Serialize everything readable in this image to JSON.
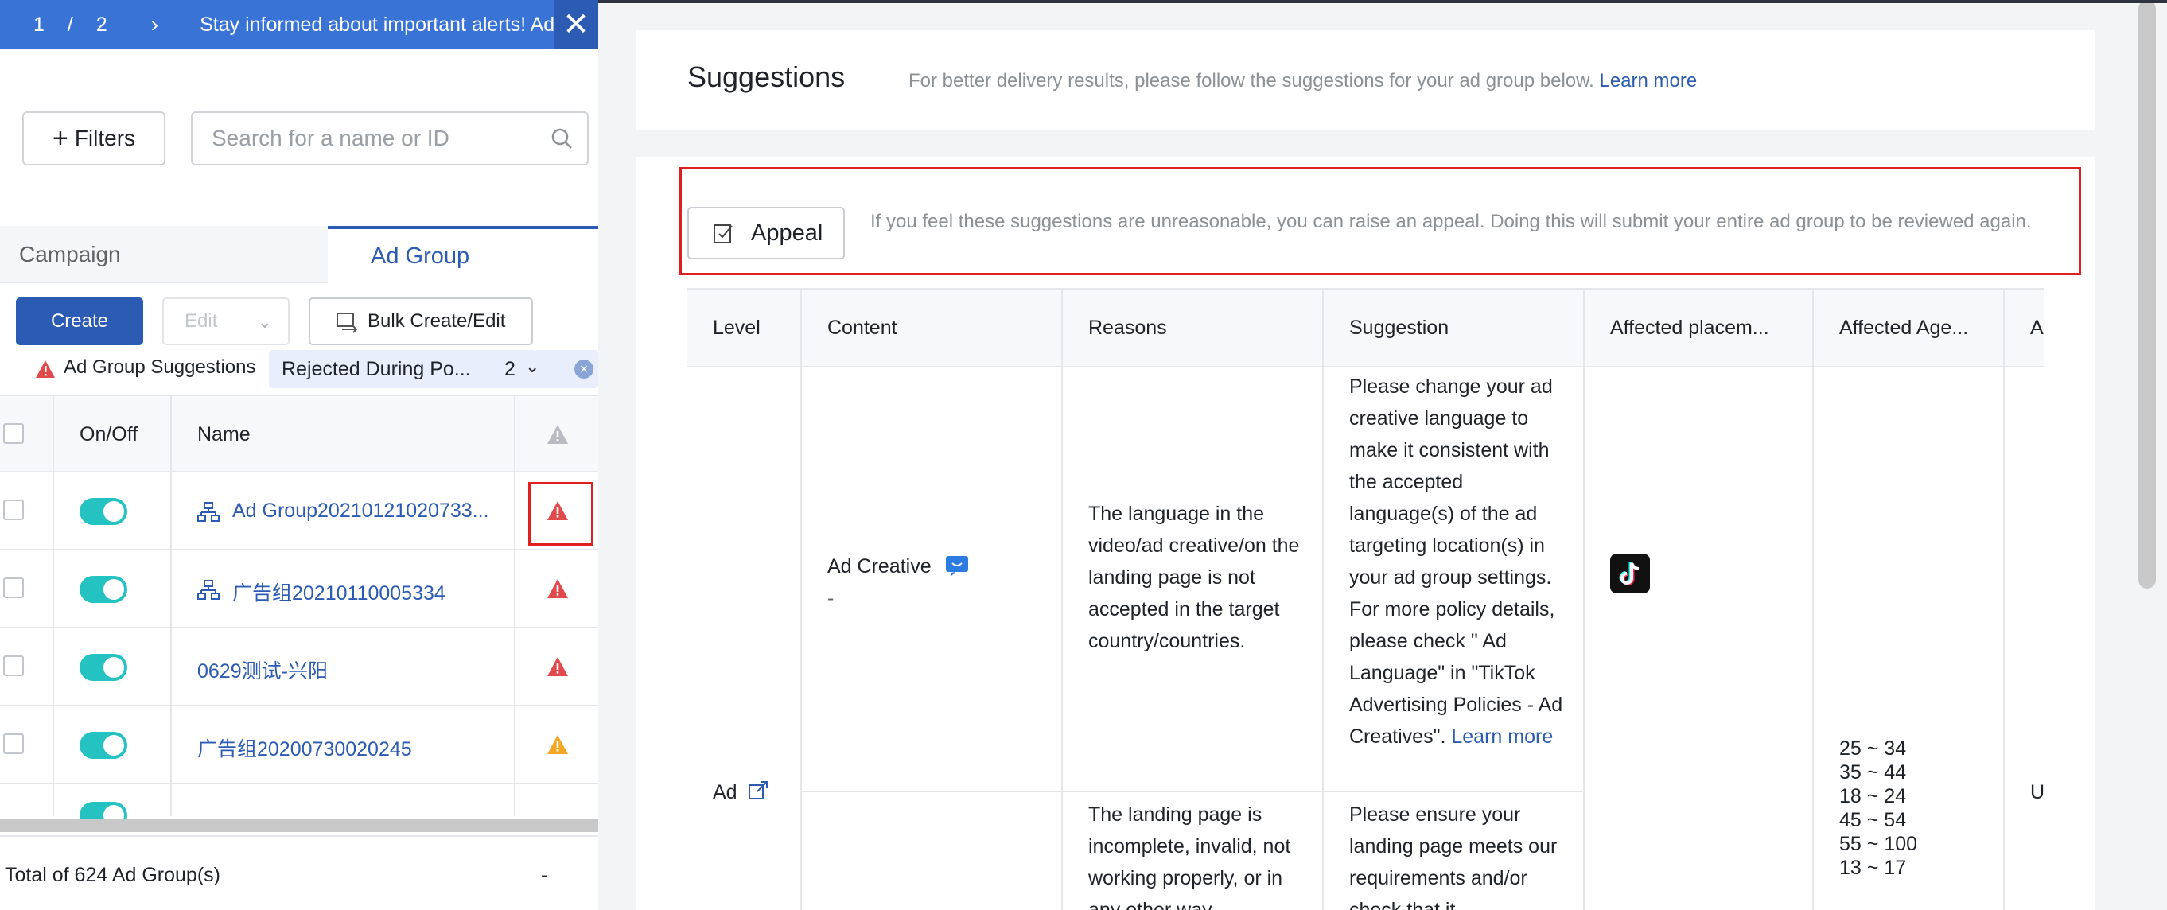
{
  "alert": {
    "page_current": "1",
    "page_sep": "/",
    "page_total": "2",
    "message": "Stay informed about important alerts! Ad"
  },
  "toolbar": {
    "filters_label": "Filters",
    "search_placeholder": "Search for a name or ID"
  },
  "tabs": {
    "campaign": "Campaign",
    "ad_group": "Ad Group"
  },
  "actions": {
    "create": "Create",
    "edit": "Edit",
    "bulk": "Bulk Create/Edit"
  },
  "filter_row": {
    "suggestions_label": "Ad Group Suggestions",
    "chip_label": "Rejected During Po...",
    "chip_count": "2"
  },
  "table": {
    "headers": {
      "onoff": "On/Off",
      "name": "Name"
    },
    "rows": [
      {
        "name": "Ad Group20210121020733...",
        "has_icon": true,
        "warn": "red"
      },
      {
        "name": "广告组20210110005334",
        "has_icon": true,
        "warn": "red"
      },
      {
        "name": "0629测试-兴阳",
        "has_icon": false,
        "warn": "red"
      },
      {
        "name": "广告组20200730020245",
        "has_icon": false,
        "warn": "orange"
      }
    ],
    "total": "Total of 624 Ad Group(s)",
    "total_dash": "-"
  },
  "suggestions": {
    "title": "Suggestions",
    "description": "For better delivery results, please follow the suggestions for your ad group below.",
    "learn_more": "Learn more",
    "appeal_button": "Appeal",
    "appeal_text": "If you feel these suggestions are unreasonable, you can raise an appeal. Doing this will submit your entire ad group to be reviewed again.",
    "headers": {
      "level": "Level",
      "content": "Content",
      "reasons": "Reasons",
      "suggestion": "Suggestion",
      "placements": "Affected placem...",
      "ages": "Affected Age...",
      "extra": "A"
    },
    "level_value": "Ad",
    "content_value": "Ad Creative",
    "content_sub": "-",
    "reason_1": "The language in the video/ad creative/on the landing page is not accepted in the target country/countries.",
    "suggestion_1": "Please change your ad creative language to make it consistent with the accepted language(s) of the ad targeting location(s) in your ad group settings. For more policy details, please check \" Ad Language\" in \"TikTok Advertising Policies - Ad Creatives\".",
    "suggestion_1_link": "Learn more",
    "reason_2": "The landing page is incomplete, invalid, not working properly, or in any other way",
    "suggestion_2": "Please ensure your landing page meets our requirements and/or check that it",
    "ages": [
      "25 ~ 34",
      "35 ~ 44",
      "18 ~ 24",
      "45 ~ 54",
      "55 ~ 100",
      "13 ~ 17"
    ],
    "extra_value": "U"
  },
  "colors": {
    "brand": "#2b5bb3",
    "alert_bar": "#3a73d6",
    "toggle_on": "#25c2c2",
    "warn_red": "#e04a4a",
    "warn_orange": "#f5a623",
    "highlight": "#e02020"
  }
}
